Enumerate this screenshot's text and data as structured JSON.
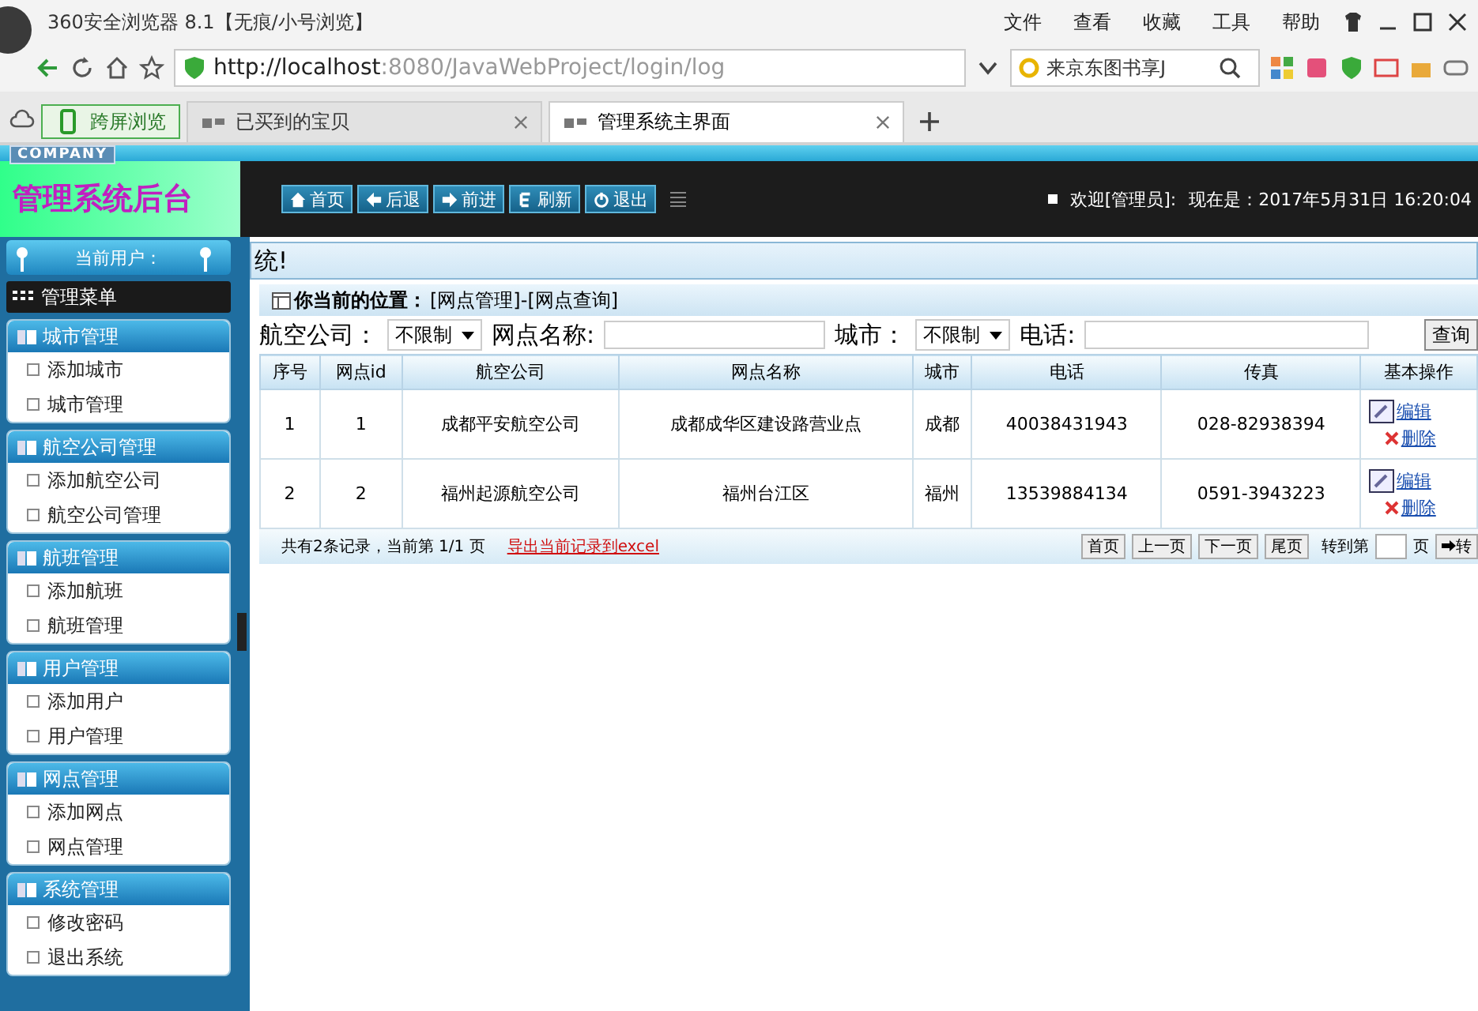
{
  "browser": {
    "title": "360安全浏览器 8.1【无痕/小号浏览】",
    "menu": [
      "文件",
      "查看",
      "收藏",
      "工具",
      "帮助"
    ],
    "url_host": "http://localhost",
    "url_rest": ":8080/JavaWebProject/login/log",
    "search_placeholder": "来京东图书享J",
    "tabs": [
      {
        "label": "跨屏浏览",
        "kind": "pill",
        "selected": false
      },
      {
        "label": "已买到的宝贝",
        "kind": "tab",
        "selected": false
      },
      {
        "label": "管理系统主界面",
        "kind": "tab",
        "selected": true
      }
    ]
  },
  "header": {
    "badge": "COMPANY",
    "title": "管理系统后台",
    "nav": [
      "首页",
      "后退",
      "前进",
      "刷新",
      "退出"
    ],
    "welcome": "欢迎[管理员]:",
    "time": "现在是：2017年5月31日 16:20:04"
  },
  "sidebar": {
    "user_label": "当前用户：",
    "menu_title": "管理菜单",
    "groups": [
      {
        "title": "城市管理",
        "items": [
          "添加城市",
          "城市管理"
        ]
      },
      {
        "title": "航空公司管理",
        "items": [
          "添加航空公司",
          "航空公司管理"
        ]
      },
      {
        "title": "航班管理",
        "items": [
          "添加航班",
          "航班管理"
        ]
      },
      {
        "title": "用户管理",
        "items": [
          "添加用户",
          "用户管理"
        ]
      },
      {
        "title": "网点管理",
        "items": [
          "添加网点",
          "网点管理"
        ]
      },
      {
        "title": "系统管理",
        "items": [
          "修改密码",
          "退出系统"
        ]
      }
    ]
  },
  "marquee": "统!",
  "breadcrumb": {
    "label": "你当前的位置：",
    "path": "[网点管理]-[网点查询]"
  },
  "filters": [
    {
      "kind": "select",
      "label": "航空公司：",
      "value": "不限制"
    },
    {
      "kind": "text",
      "label": "网点名称:"
    },
    {
      "kind": "select",
      "label": "城市：",
      "value": "不限制"
    },
    {
      "kind": "text",
      "label": "电话:"
    }
  ],
  "query_button": "查询",
  "table": {
    "columns": [
      "序号",
      "网点id",
      "航空公司",
      "网点名称",
      "城市",
      "电话",
      "传真",
      "基本操作"
    ],
    "rows": [
      {
        "cells": [
          "1",
          "1",
          "成都平安航空公司",
          "成都成华区建设路营业点",
          "成都",
          "40038431943",
          "028-82938394"
        ],
        "actions": [
          "编辑",
          "删除"
        ]
      },
      {
        "cells": [
          "2",
          "2",
          "福州起源航空公司",
          "福州台江区",
          "福州",
          "13539884134",
          "0591-3943223"
        ],
        "actions": [
          "编辑",
          "删除"
        ]
      }
    ]
  },
  "pager": {
    "summary": "共有2条记录，当前第 1/1 页",
    "export_link": "导出当前记录到excel",
    "buttons": [
      "首页",
      "上一页",
      "下一页",
      "尾页"
    ],
    "goto_label": "转到第",
    "page_suffix": "页",
    "go_button": "转"
  }
}
